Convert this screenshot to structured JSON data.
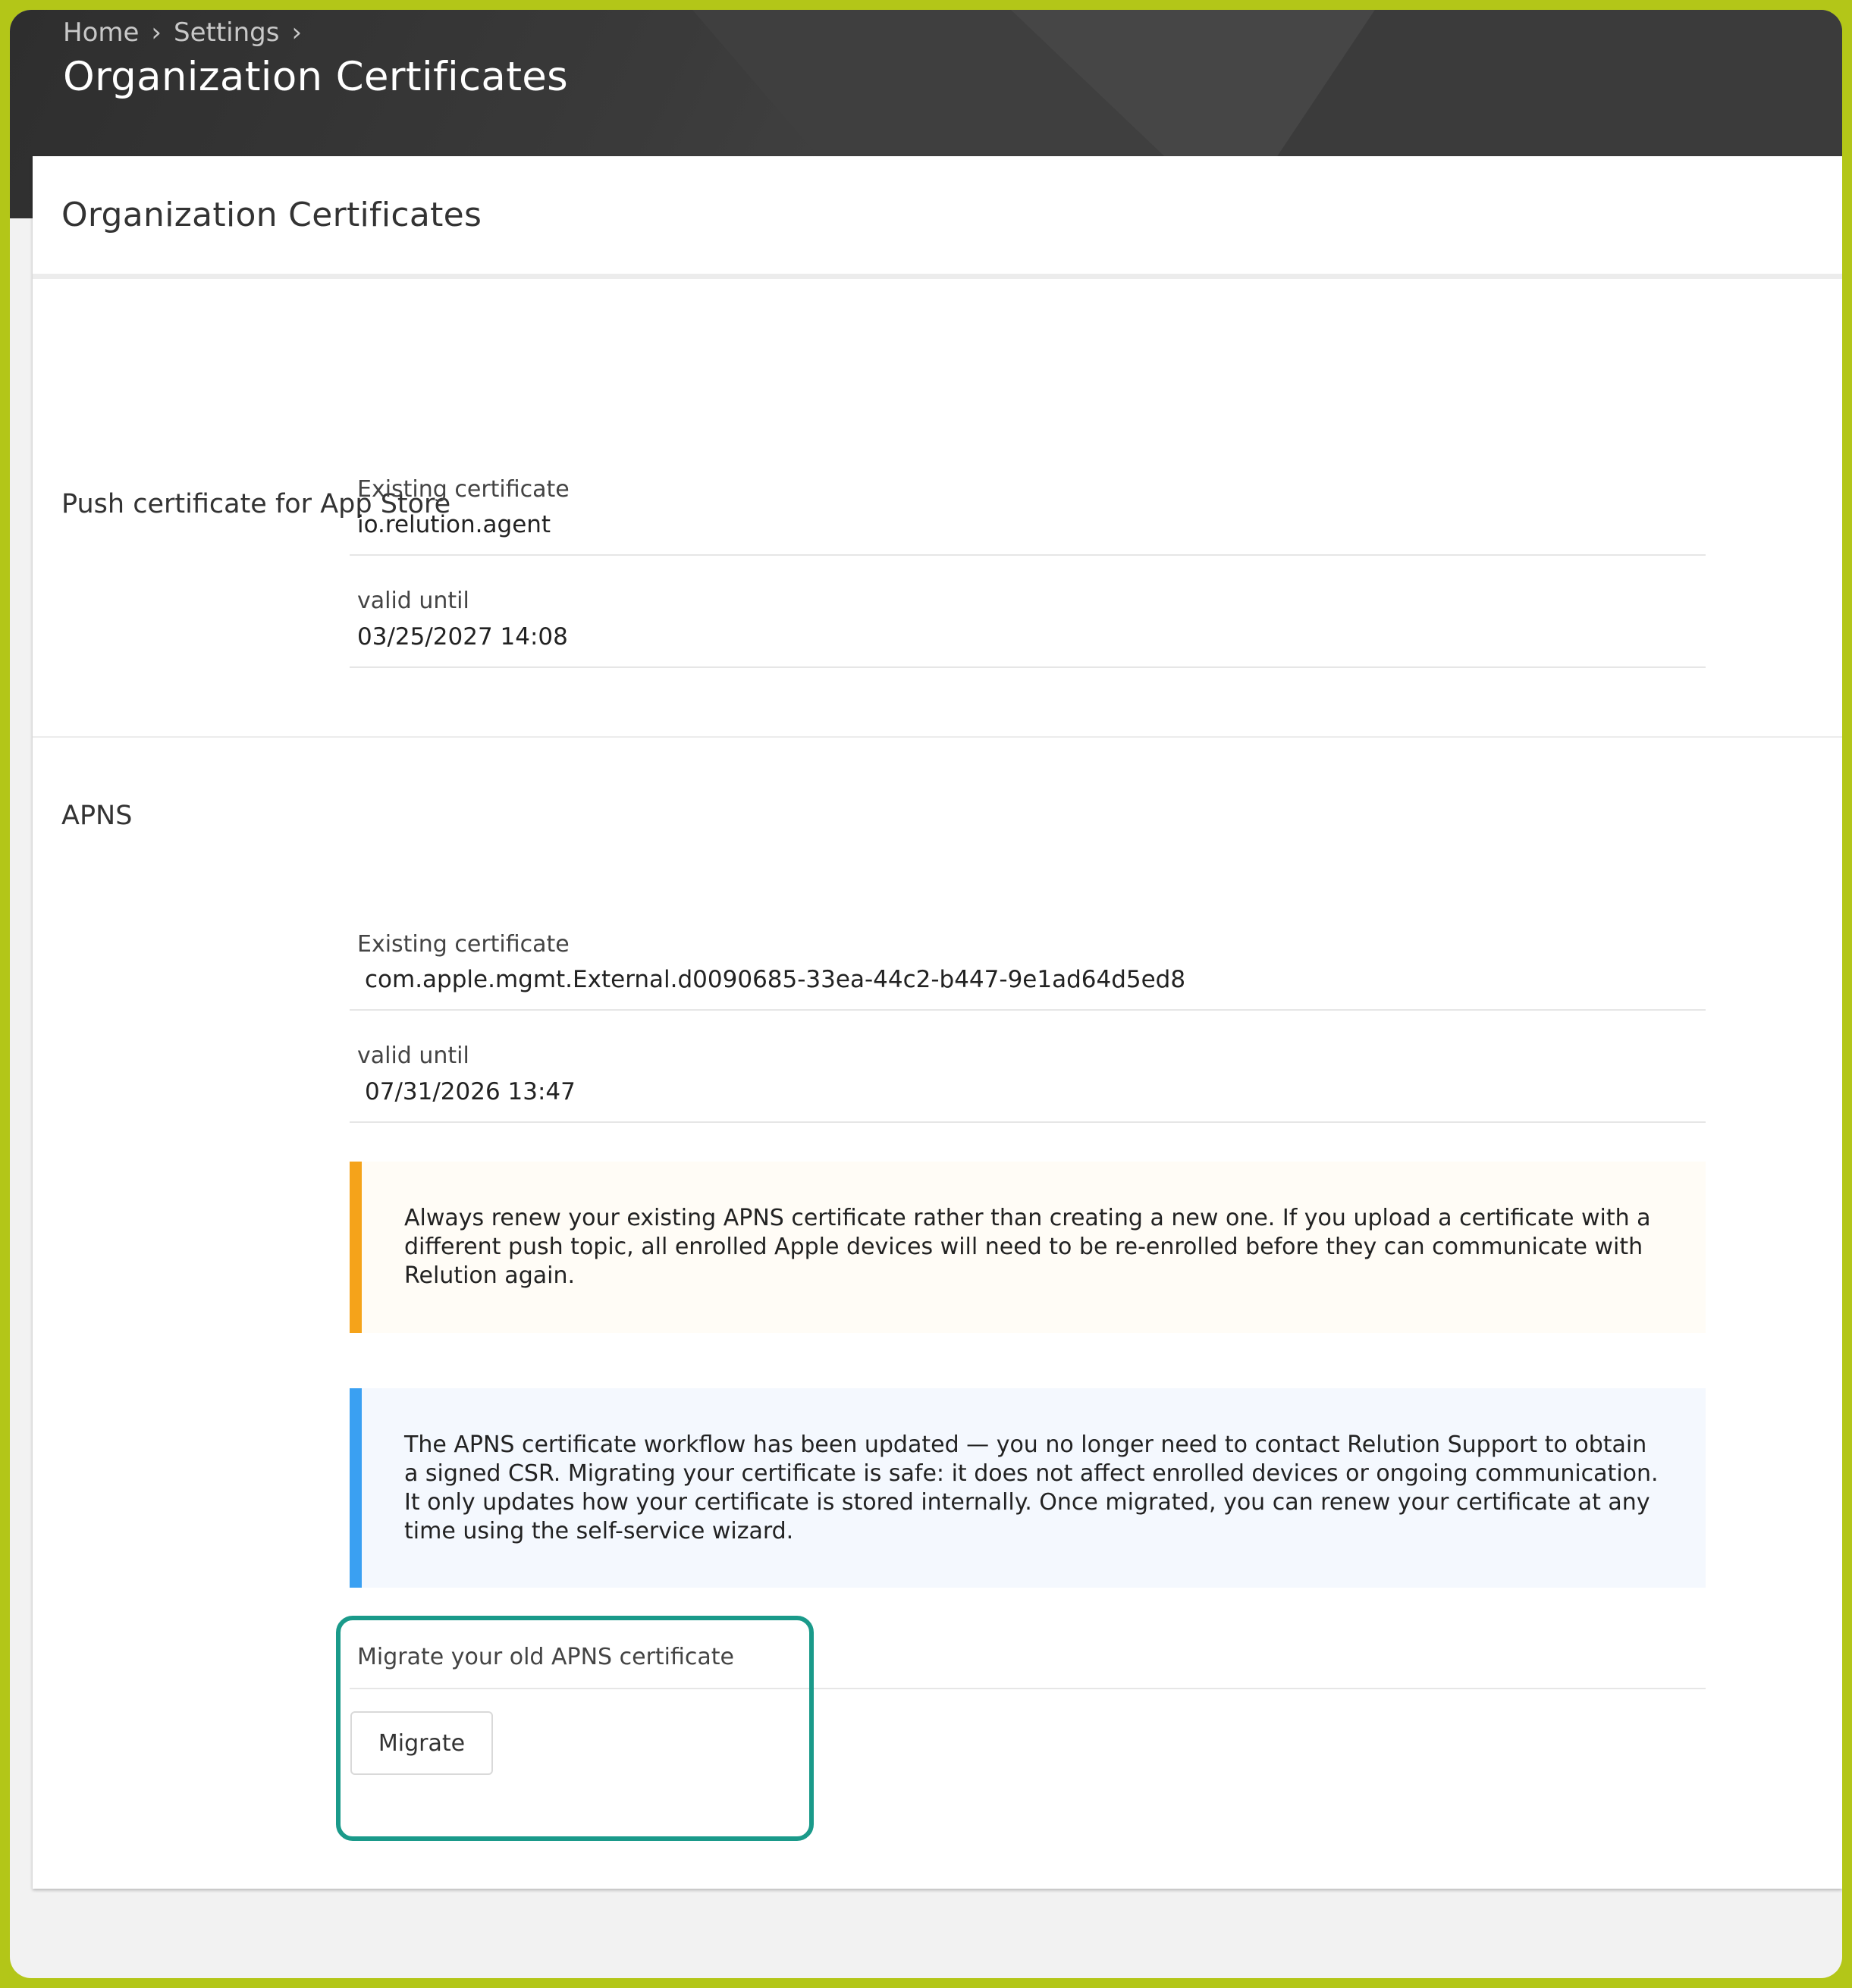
{
  "breadcrumb": {
    "items": [
      "Home",
      "Settings"
    ]
  },
  "header": {
    "title": "Organization Certificates"
  },
  "card": {
    "title": "Organization Certificates"
  },
  "push_certificate": {
    "title": "Push certificate for App Store",
    "existing_label": "Existing certificate",
    "existing_value": "io.relution.agent",
    "valid_label": "valid until",
    "valid_value": "03/25/2027 14:08"
  },
  "apns": {
    "title": "APNS",
    "existing_label": "Existing certificate",
    "existing_value": "com.apple.mgmt.External.d0090685-33ea-44c2-b447-9e1ad64d5ed8",
    "valid_label": "valid until",
    "valid_value": "07/31/2026 13:47",
    "warning_text": "Always renew your existing APNS certificate rather than creating a new one. If you upload a certificate with a different push topic, all enrolled Apple devices will need to be re-enrolled before they can communicate with Relution again.",
    "info_text": "The APNS certificate workflow has been updated — you no longer need to contact Relution Support to obtain a signed CSR. Migrating your certificate is safe: it does not affect enrolled devices or ongoing communication. It only updates how your certificate is stored internally. Once migrated, you can renew your certificate at any time using the self-service wizard.",
    "migrate_label": "Migrate your old APNS certificate",
    "migrate_button": "Migrate"
  },
  "colors": {
    "frame_border": "#b3c618",
    "warning_accent": "#f5a31a",
    "info_accent": "#3aa0f2",
    "highlight": "#1a9a8a"
  }
}
